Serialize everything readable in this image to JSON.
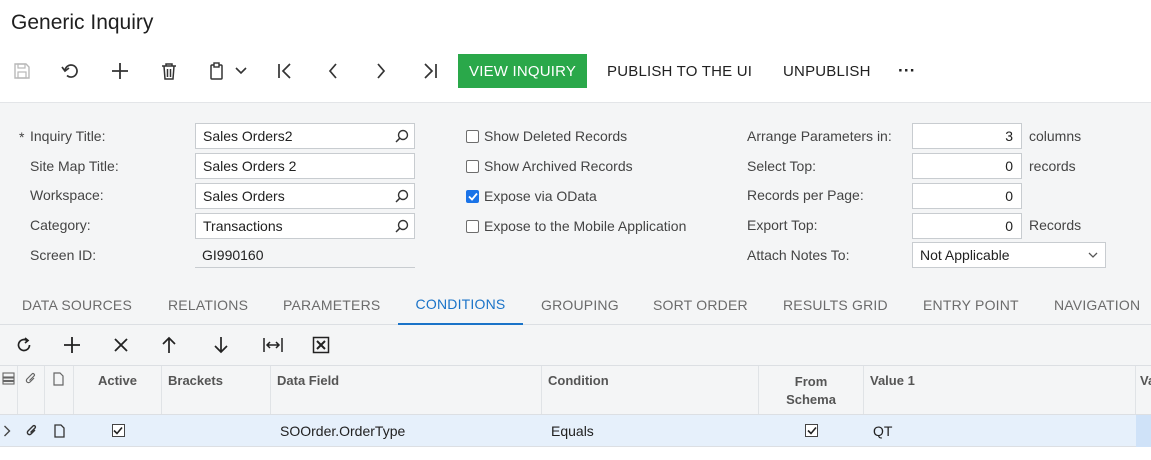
{
  "page": {
    "title": "Generic Inquiry"
  },
  "toolbar": {
    "view_inquiry": "VIEW INQUIRY",
    "publish": "PUBLISH TO THE UI",
    "unpublish": "UNPUBLISH",
    "more": "···"
  },
  "form": {
    "required_mark": "*",
    "inquiry_title_label": "Inquiry Title:",
    "inquiry_title_value": "Sales Orders2",
    "site_map_title_label": "Site Map Title:",
    "site_map_title_value": "Sales Orders 2",
    "workspace_label": "Workspace:",
    "workspace_value": "Sales Orders",
    "category_label": "Category:",
    "category_value": "Transactions",
    "screen_id_label": "Screen ID:",
    "screen_id_value": "GI990160",
    "show_deleted": {
      "label": "Show Deleted Records",
      "checked": false
    },
    "show_archived": {
      "label": "Show Archived Records",
      "checked": false
    },
    "expose_odata": {
      "label": "Expose via OData",
      "checked": true
    },
    "expose_mobile": {
      "label": "Expose to the Mobile Application",
      "checked": false
    },
    "arrange_label": "Arrange Parameters in:",
    "arrange_value": "3",
    "arrange_unit": "columns",
    "select_top_label": "Select Top:",
    "select_top_value": "0",
    "select_top_unit": "records",
    "records_per_page_label": "Records per Page:",
    "records_per_page_value": "0",
    "export_top_label": "Export Top:",
    "export_top_value": "0",
    "export_top_unit": "Records",
    "attach_notes_label": "Attach Notes To:",
    "attach_notes_value": "Not Applicable"
  },
  "tabs": [
    {
      "label": "DATA SOURCES",
      "active": false
    },
    {
      "label": "RELATIONS",
      "active": false
    },
    {
      "label": "PARAMETERS",
      "active": false
    },
    {
      "label": "CONDITIONS",
      "active": true
    },
    {
      "label": "GROUPING",
      "active": false
    },
    {
      "label": "SORT ORDER",
      "active": false
    },
    {
      "label": "RESULTS GRID",
      "active": false
    },
    {
      "label": "ENTRY POINT",
      "active": false
    },
    {
      "label": "NAVIGATION",
      "active": false
    }
  ],
  "grid": {
    "columns": {
      "active": "Active",
      "brackets": "Brackets",
      "data_field": "Data Field",
      "condition": "Condition",
      "from_schema_1": "From",
      "from_schema_2": "Schema",
      "value1": "Value 1",
      "value2_partial": "Va"
    },
    "rows": [
      {
        "active": true,
        "brackets": "",
        "data_field": "SOOrder.OrderType",
        "condition": "Equals",
        "from_schema": true,
        "value1": "QT"
      }
    ]
  },
  "colors": {
    "accent_green": "#2aa84a",
    "tab_active_blue": "#1a73c8",
    "row_selected": "#e6f0fb"
  }
}
